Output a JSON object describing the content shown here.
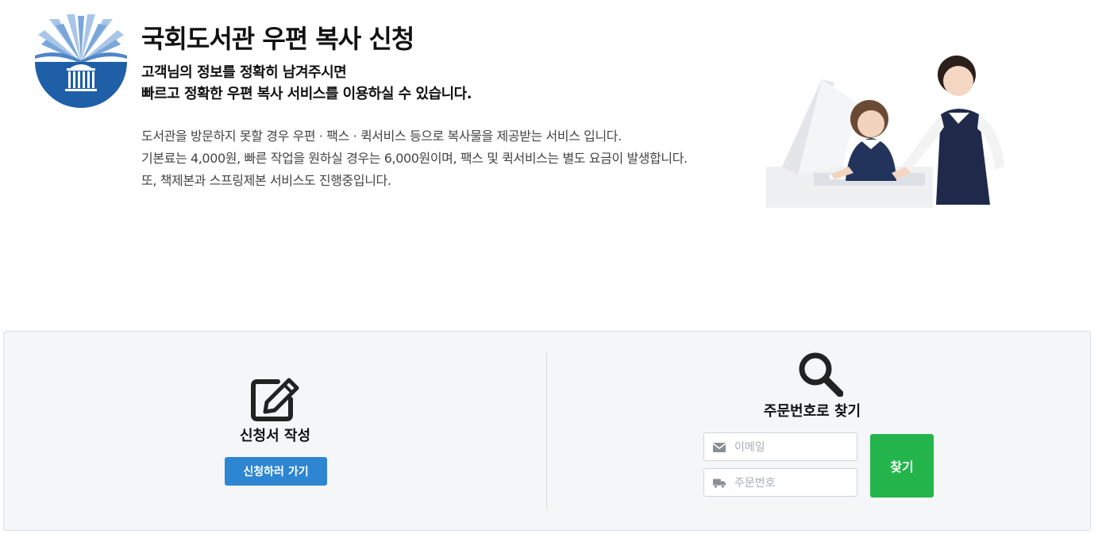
{
  "banner": {
    "title": "국회도서관 우편 복사 신청",
    "subtitle_line1": "고객님의 정보를 정확히 남겨주시면",
    "subtitle_line2": "빠르고 정확한 우편 복사 서비스를 이용하실 수 있습니다.",
    "desc_line1": "도서관을 방문하지 못할 경우 우편 · 팩스 · 퀵서비스 등으로 복사물을 제공받는 서비스 입니다.",
    "desc_line2": "기본료는 4,000원, 빠른 작업을 원하실 경우는 6,000원이며, 팩스 및 퀵서비스는 별도 요금이 발생합니다.",
    "desc_line3": "또, 책제본과 스프링제본 서비스도 진행중입니다."
  },
  "apply": {
    "icon": "edit-icon",
    "title": "신청서 작성",
    "button_label": "신청하러 가기",
    "button_color": "#2e86d3"
  },
  "lookup": {
    "icon": "search-icon",
    "title": "주문번호로 찾기",
    "email_icon": "envelope-icon",
    "email_placeholder": "이메일",
    "order_icon": "truck-icon",
    "order_placeholder": "주문번호",
    "button_label": "찾기",
    "button_color": "#23b54b"
  },
  "colors": {
    "panel_bg": "#f5f6f8",
    "logo_blue": "#1f5fa8"
  }
}
